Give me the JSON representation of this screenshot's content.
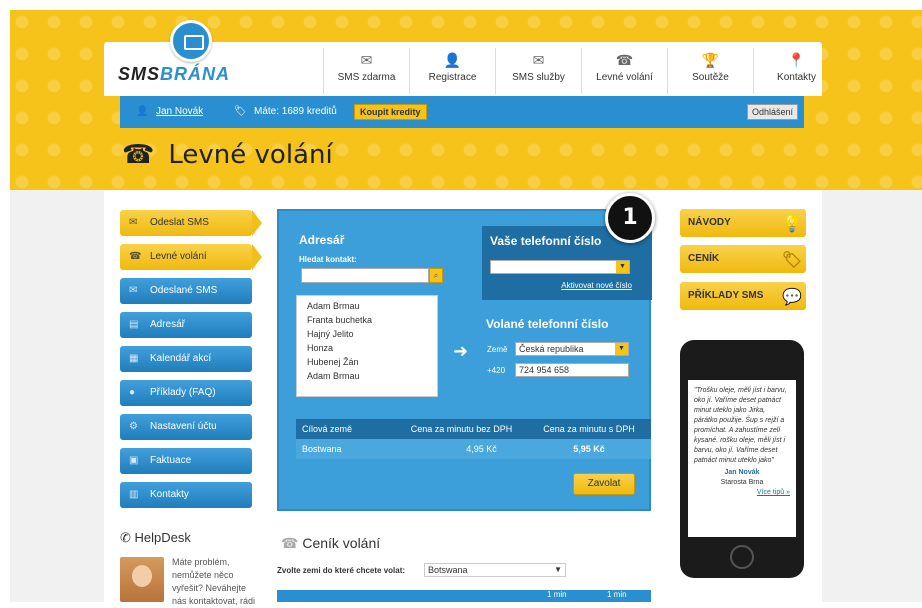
{
  "brand": {
    "part1": "SMS",
    "part2": "BRÁNA"
  },
  "nav": [
    {
      "label": "SMS zdarma",
      "icon": "envelope-icon"
    },
    {
      "label": "Registrace",
      "icon": "user-icon"
    },
    {
      "label": "SMS služby",
      "icon": "envelopes-icon"
    },
    {
      "label": "Levné volání",
      "icon": "phone-icon"
    },
    {
      "label": "Soutěže",
      "icon": "trophy-icon"
    },
    {
      "label": "Kontakty",
      "icon": "map-pin-icon"
    }
  ],
  "userbar": {
    "user": "Jan Novák",
    "credits": "Máte: 1689 kreditů",
    "buy": "Koupit kredity",
    "logout": "Odhlášení"
  },
  "page_title": "Levné volání",
  "sidebar": [
    {
      "label": "Odeslat SMS",
      "icon": "envelope-icon",
      "style": "yellow"
    },
    {
      "label": "Levné volání",
      "icon": "phone-icon",
      "style": "yellow-active"
    },
    {
      "label": "Odeslané SMS",
      "icon": "envelope-icon",
      "style": "blue"
    },
    {
      "label": "Adresář",
      "icon": "book-icon",
      "style": "blue"
    },
    {
      "label": "Kalendář akcí",
      "icon": "calendar-icon",
      "style": "blue"
    },
    {
      "label": "Příklady (FAQ)",
      "icon": "bulb-icon",
      "style": "blue"
    },
    {
      "label": "Nastavení účtu",
      "icon": "gear-icon",
      "style": "blue"
    },
    {
      "label": "Faktuace",
      "icon": "invoice-icon",
      "style": "blue"
    },
    {
      "label": "Kontakty",
      "icon": "people-icon",
      "style": "blue"
    }
  ],
  "helpdesk": {
    "title": "HelpDesk",
    "text": "Máte problém, nemůžete něco vyřešit? Neváhejte nás kontaktovat, rádi"
  },
  "panel": {
    "address_title": "Adresář",
    "search_label": "Hledat kontakt:",
    "search_value": "",
    "contacts": [
      "Adam Brmau",
      "Franta buchetka",
      "Hajný Jelito",
      "Honza",
      "Hubenej Žán",
      "Adam Brmau"
    ],
    "your_number_title": "Vaše telefonní číslo",
    "your_number_value": "",
    "activate_link": "Aktivovat nové číslo",
    "called_title": "Volané telefonní číslo",
    "country_label": "Země",
    "country_value": "Česká republika",
    "prefix": "+420",
    "phone_value": "724 954 658",
    "table_headers": [
      "Cílová země",
      "Cena za minutu bez DPH",
      "Cena za minutu s DPH"
    ],
    "table_row": [
      "Bostwana",
      "4,95 Kč",
      "5,95 Kč"
    ],
    "call_button": "Zavolat"
  },
  "badge": "1",
  "right_buttons": [
    {
      "label": "NÁVODY",
      "icon": "bulb-icon"
    },
    {
      "label": "CENÍK",
      "icon": "tag-icon"
    },
    {
      "label": "PŘÍKLADY SMS",
      "icon": "speech-bubble-icon"
    }
  ],
  "phone_quote": {
    "text": "\"Trošku oleje, měli jíst i barvu, oko jí. Vaříme deset patnáct minut uteklo jako Jirka, párátko použije. Šup s rejží a promíchat. A zahustíme zelí kysané. rošku oleje, měli jíst i barvu, oko jí. Vaříme deset patnáct minut uteklo jako\"",
    "author": "Jan Novák",
    "role": "Starosta Brna",
    "more": "Více tipů »"
  },
  "cenik": {
    "title": "Ceník volání",
    "zeme_label": "Zvolte zemi do které chcete volat:",
    "zeme_value": "Botswana",
    "col1": "1 min",
    "col2": "1 min"
  }
}
